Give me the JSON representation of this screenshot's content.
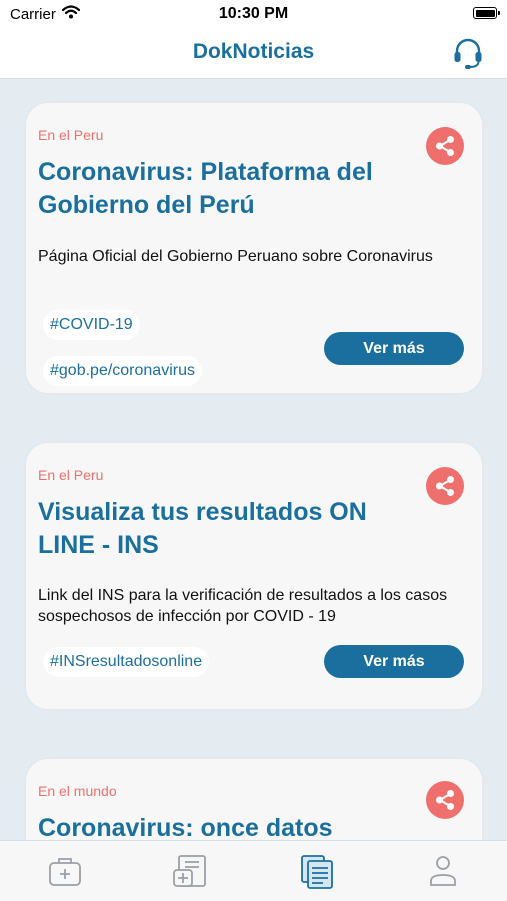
{
  "status_bar": {
    "carrier": "Carrier",
    "time": "10:30 PM"
  },
  "nav": {
    "title": "DokNoticias",
    "support_icon": "headset-icon"
  },
  "cards": [
    {
      "category": "En el Peru",
      "title": "Coronavirus: Plataforma del Gobierno del Perú",
      "description": "Página Oficial del Gobierno Peruano sobre Coronavirus",
      "tags": [
        "#COVID-19",
        "#gob.pe/coronavirus"
      ],
      "button": "Ver más"
    },
    {
      "category": "En el Peru",
      "title": "Visualiza tus resultados ON LINE - INS",
      "description": "Link del INS para la verificación de resultados a los casos sospechosos de infección por COVID - 19",
      "tags": [
        "#INSresultadosonline"
      ],
      "button": "Ver más"
    },
    {
      "category": "En el mundo",
      "title": "Coronavirus: once datos",
      "description": "",
      "tags": [],
      "button": ""
    }
  ],
  "tabs": [
    {
      "icon": "medical-kit-icon",
      "active": false
    },
    {
      "icon": "medical-record-icon",
      "active": false
    },
    {
      "icon": "news-icon",
      "active": true
    },
    {
      "icon": "profile-icon",
      "active": false
    }
  ],
  "colors": {
    "primary": "#1b6f9e",
    "accent": "#ef6f6c",
    "background": "#e5ecf1",
    "card": "#f7f7f7",
    "tab_inactive": "#9aa0a6"
  }
}
